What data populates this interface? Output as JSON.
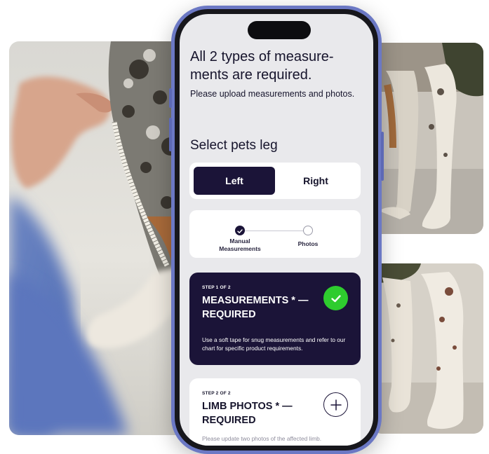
{
  "header": {
    "title": "All 2 types of measure- ments are required.",
    "subtitle": "Please upload measurements and photos."
  },
  "leg_selector": {
    "heading": "Select pets leg",
    "options": [
      "Left",
      "Right"
    ],
    "selected": "Left"
  },
  "progress": {
    "steps": [
      {
        "label": "Manual Measurements",
        "status": "done"
      },
      {
        "label": "Photos",
        "status": "pending"
      }
    ]
  },
  "cards": [
    {
      "kicker": "STEP 1 OF 2",
      "title": "MEASUREMENTS * — REQUIRED",
      "description": "Use a soft tape for snug measurements and refer to our chart for specific product requirements.",
      "status_icon": "check-icon",
      "accent": "#2ecc2e"
    },
    {
      "kicker": "STEP 2 OF 2",
      "title": "LIMB PHOTOS * — REQUIRED",
      "description": "Please update two photos of the affected limb.",
      "status_icon": "plus-icon"
    }
  ],
  "colors": {
    "phone_frame": "#6b78c4",
    "primary_dark": "#1b1438",
    "screen_bg": "#e9e9ec"
  }
}
